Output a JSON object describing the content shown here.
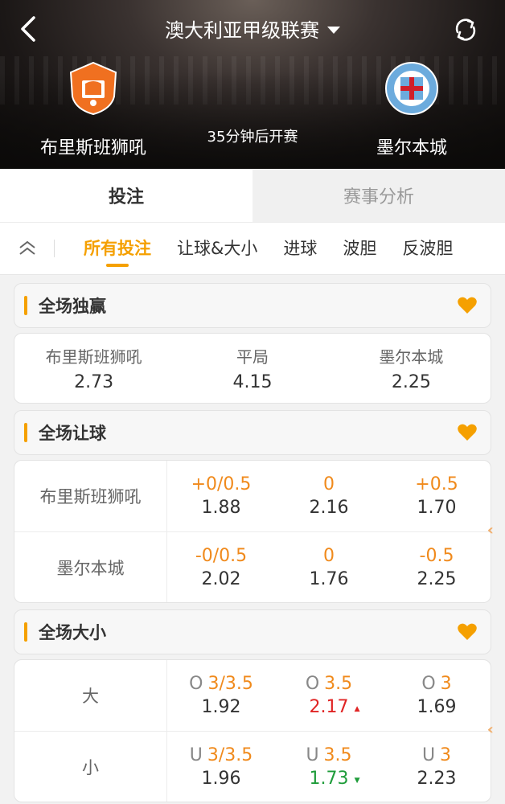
{
  "header": {
    "league_title": "澳大利亚甲级联赛",
    "home_team": "布里斯班狮吼",
    "away_team": "墨尔本城",
    "kickoff_status": "35分钟后开赛",
    "icons": {
      "back": "back-chevron-icon",
      "refresh": "refresh-icon",
      "dropdown": "caret-down-icon"
    }
  },
  "tabs": [
    "投注",
    "赛事分析"
  ],
  "sub_tabs": [
    "所有投注",
    "让球&大小",
    "进球",
    "波胆",
    "反波胆"
  ],
  "colors": {
    "accent": "#f5a000",
    "line": "#f08a1c",
    "up": "#e02424",
    "down": "#1e9c3a"
  },
  "win": {
    "title": "全场独赢",
    "options": [
      {
        "label": "布里斯班狮吼",
        "odd": "2.73"
      },
      {
        "label": "平局",
        "odd": "4.15"
      },
      {
        "label": "墨尔本城",
        "odd": "2.25"
      }
    ]
  },
  "handicap": {
    "title": "全场让球",
    "rows": [
      {
        "label": "布里斯班狮吼",
        "cells": [
          {
            "line": "+0/0.5",
            "odd": "1.88"
          },
          {
            "line": "0",
            "odd": "2.16"
          },
          {
            "line": "+0.5",
            "odd": "1.70"
          }
        ]
      },
      {
        "label": "墨尔本城",
        "cells": [
          {
            "line": "-0/0.5",
            "odd": "2.02"
          },
          {
            "line": "0",
            "odd": "1.76"
          },
          {
            "line": "-0.5",
            "odd": "2.25"
          }
        ]
      }
    ]
  },
  "totals": {
    "title": "全场大小",
    "rows": [
      {
        "label": "大",
        "prefix": "O",
        "cells": [
          {
            "line": "3/3.5",
            "odd": "1.92",
            "trend": ""
          },
          {
            "line": "3.5",
            "odd": "2.17",
            "trend": "up"
          },
          {
            "line": "3",
            "odd": "1.69",
            "trend": ""
          }
        ]
      },
      {
        "label": "小",
        "prefix": "U",
        "cells": [
          {
            "line": "3/3.5",
            "odd": "1.96",
            "trend": ""
          },
          {
            "line": "3.5",
            "odd": "1.73",
            "trend": "down"
          },
          {
            "line": "3",
            "odd": "2.23",
            "trend": ""
          }
        ]
      }
    ]
  }
}
